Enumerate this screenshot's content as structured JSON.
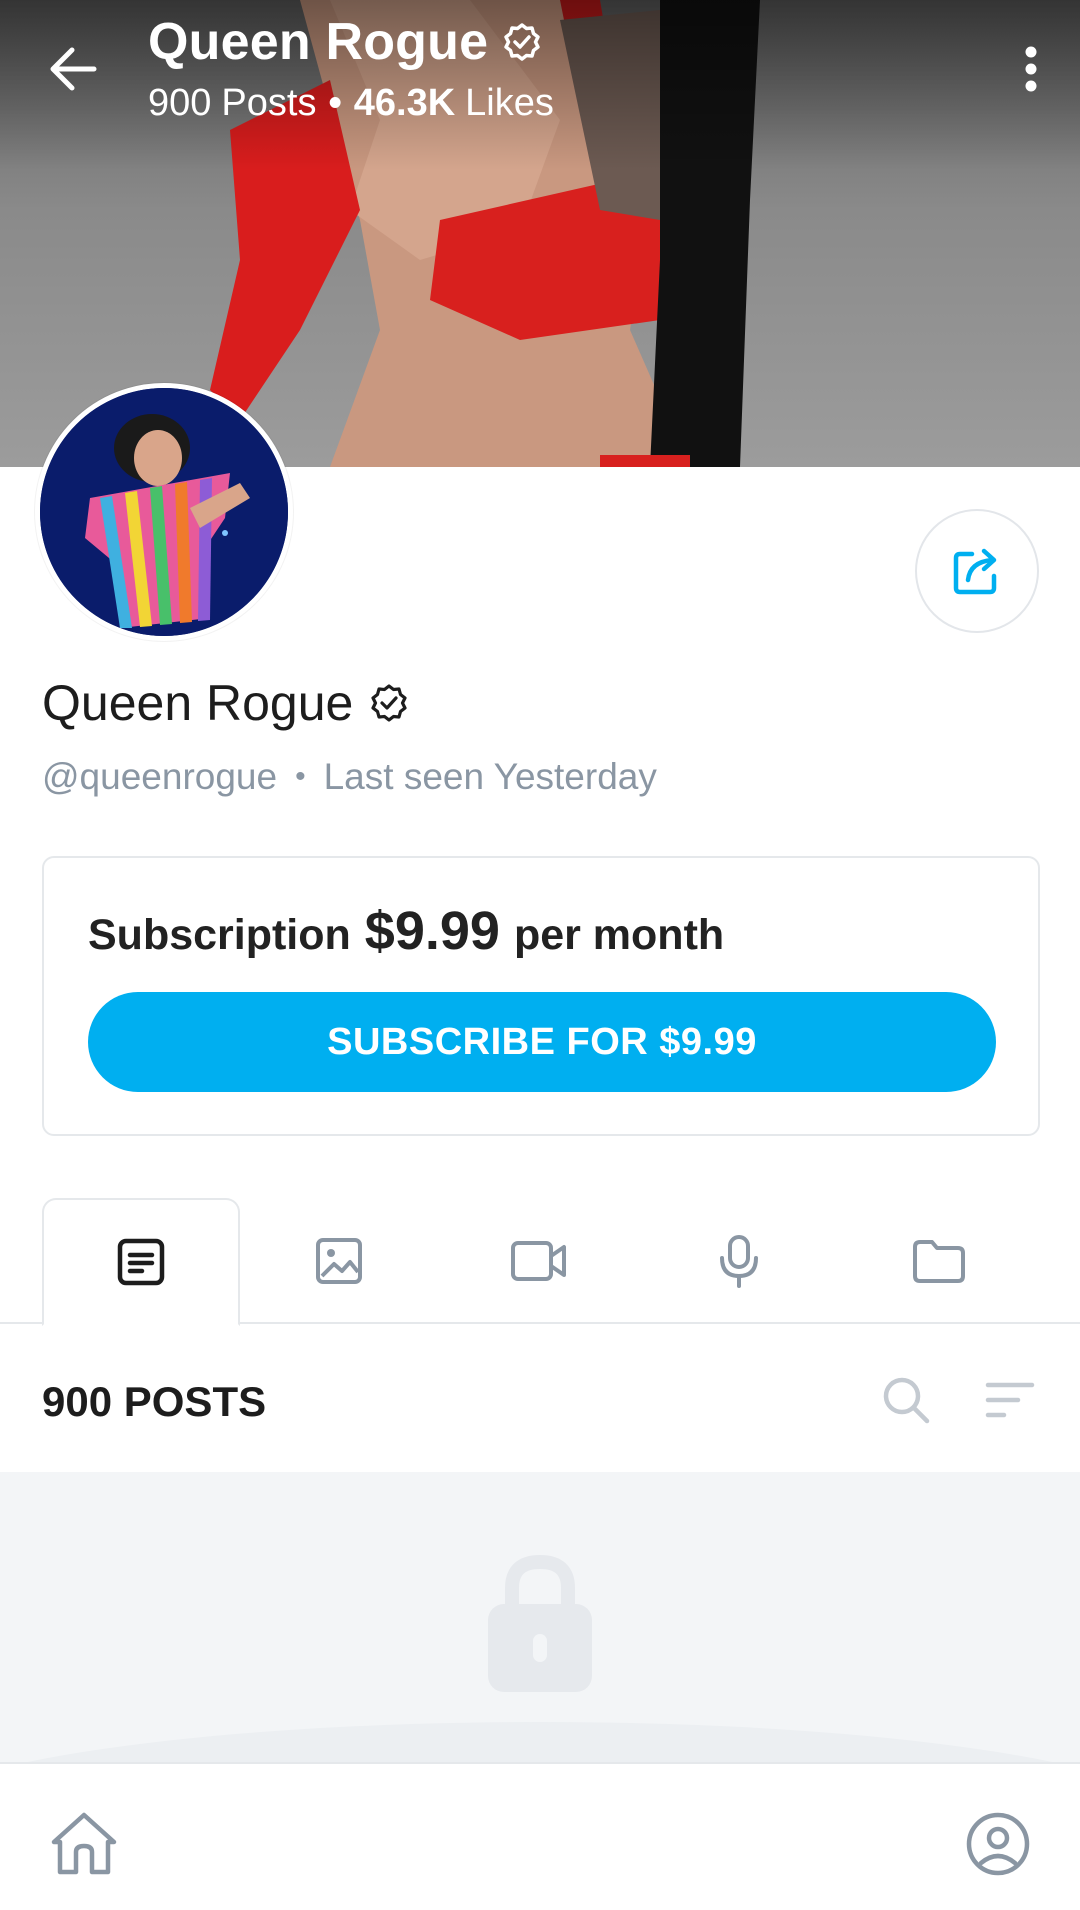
{
  "header": {
    "name": "Queen Rogue",
    "posts_count": "900",
    "posts_word": "Posts",
    "likes_count": "46.3K",
    "likes_word": "Likes"
  },
  "profile": {
    "name": "Queen Rogue",
    "handle": "@queenrogue",
    "last_seen": "Last seen Yesterday"
  },
  "subscription": {
    "label": "Subscription",
    "price": "$9.99",
    "period": "per month",
    "button_label": "SUBSCRIBE FOR $9.99"
  },
  "tabs": [
    {
      "name": "posts",
      "icon": "post-icon",
      "active": true
    },
    {
      "name": "photos",
      "icon": "image-icon",
      "active": false
    },
    {
      "name": "videos",
      "icon": "video-icon",
      "active": false
    },
    {
      "name": "audio",
      "icon": "microphone-icon",
      "active": false
    },
    {
      "name": "collections",
      "icon": "folder-icon",
      "active": false
    }
  ],
  "posts_section": {
    "title": "900 POSTS"
  },
  "colors": {
    "accent": "#00aff0",
    "muted_text": "#8a96a3",
    "border": "#e5e8eb"
  },
  "icons": {
    "back": "arrow-left-icon",
    "more": "more-vertical-icon",
    "verified": "verified-badge-icon",
    "share": "share-icon",
    "search": "search-icon",
    "sort": "sort-icon",
    "lock": "lock-icon",
    "home": "home-icon",
    "profile": "user-circle-icon"
  }
}
